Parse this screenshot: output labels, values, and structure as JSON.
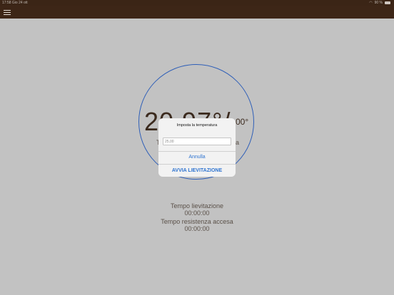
{
  "status": {
    "time": "17:58",
    "date": "Gio 24 ott",
    "battery": "90 %"
  },
  "main": {
    "temp_big": "20,97°/",
    "temp_small": "00°",
    "hidden_left": "T",
    "hidden_right": "a"
  },
  "info": {
    "leavening_label": "Tempo lievitazione",
    "leavening_value": "00:00:00",
    "heater_label": "Tempo resistenza accesa",
    "heater_value": "00:00:00"
  },
  "dialog": {
    "title": "Imposta la temperatura",
    "input_value": "25,00",
    "cancel_label": "Annulla",
    "start_label": "AVVIA LIEVITAZIONE"
  },
  "colors": {
    "navbar": "#3d2617",
    "ring": "#2f5fb8",
    "button": "#2f74d0"
  }
}
